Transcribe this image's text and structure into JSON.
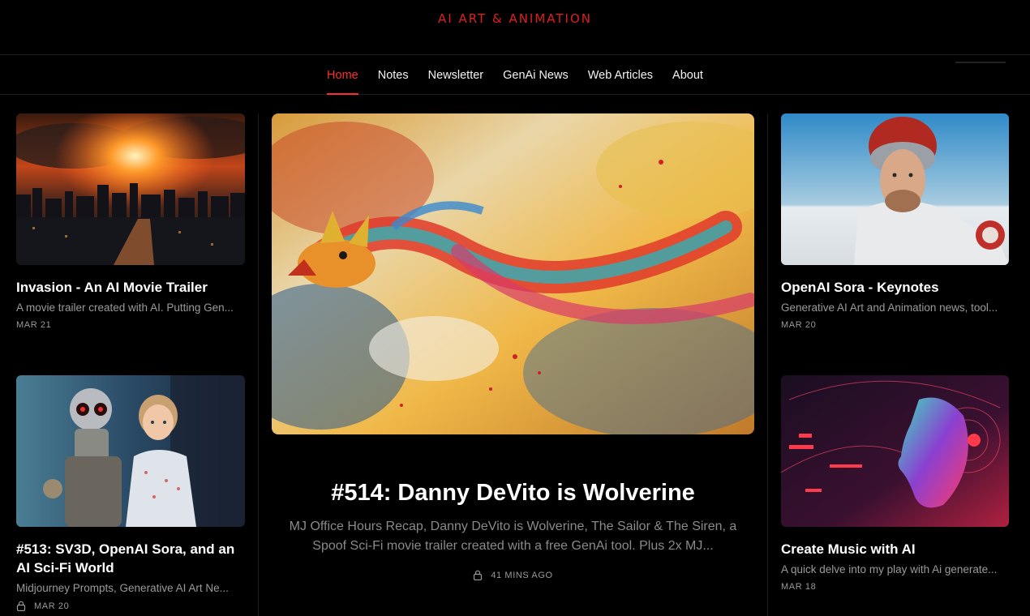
{
  "site": {
    "logo": "AI ART & ANIMATION"
  },
  "nav": {
    "items": [
      {
        "label": "Home",
        "active": true
      },
      {
        "label": "Notes"
      },
      {
        "label": "Newsletter"
      },
      {
        "label": "GenAi News"
      },
      {
        "label": "Web Articles"
      },
      {
        "label": "About"
      }
    ]
  },
  "left_posts": [
    {
      "title": "Invasion - An AI Movie Trailer",
      "excerpt": "A movie trailer created with AI. Putting Gen...",
      "date": "MAR 21",
      "image": "city-explosion-image"
    },
    {
      "title": "#513: SV3D, OpenAI Sora, and an AI Sci-Fi World",
      "excerpt": "Midjourney Prompts, Generative AI Art Ne...",
      "date": "MAR 20",
      "locked": true,
      "image": "robot-and-boy-image"
    }
  ],
  "featured": {
    "title": "#514: Danny DeVito is Wolverine",
    "excerpt": "MJ Office Hours Recap, Danny DeVito is Wolverine, The Sailor & The Siren, a Spoof Sci-Fi movie trailer created with a free GenAi tool. Plus 2x MJ...",
    "meta": "41 MINS AGO",
    "locked": true,
    "image": "dragon-painting-image"
  },
  "right_posts": [
    {
      "title": "OpenAI Sora - Keynotes",
      "excerpt": "Generative AI Art and Animation news, tool...",
      "date": "MAR 20",
      "image": "astronaut-image"
    },
    {
      "title": "Create Music with AI",
      "excerpt": "A quick delve into my play with Ai generate...",
      "date": "MAR 18",
      "image": "neon-face-image"
    }
  ],
  "colors": {
    "accent": "#ff2d2d",
    "background": "#000000",
    "muted_text": "#9a9a9a"
  }
}
